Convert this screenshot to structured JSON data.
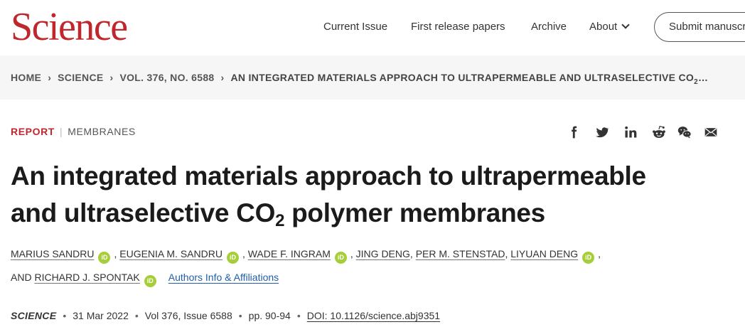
{
  "header": {
    "logo": "Science",
    "nav": [
      "Current Issue",
      "First release papers",
      "Archive",
      "About"
    ],
    "submit_label": "Submit manuscript"
  },
  "breadcrumb": {
    "items": [
      "HOME",
      "SCIENCE",
      "VOL. 376, NO. 6588"
    ],
    "current_pre": "AN INTEGRATED MATERIALS APPROACH TO ULTRAPERMEABLE AND ULTRASELECTIVE CO",
    "current_sub": "2",
    "current_post": "…"
  },
  "article": {
    "type": "REPORT",
    "topic": "MEMBRANES",
    "title_line1": "An integrated materials approach to ultrapermeable",
    "title_line2_pre": "and ultraselective CO",
    "title_sub": "2",
    "title_line2_post": " polymer membranes",
    "authors": [
      {
        "name": "MARIUS SANDRU",
        "orcid": true,
        "sep": ","
      },
      {
        "name": "EUGENIA M. SANDRU",
        "orcid": true,
        "sep": ","
      },
      {
        "name": "WADE F. INGRAM",
        "orcid": true,
        "sep": ","
      },
      {
        "name": "JING DENG",
        "orcid": false,
        "sep": ","
      },
      {
        "name": "PER M. STENSTAD",
        "orcid": false,
        "sep": ","
      },
      {
        "name": "LIYUAN DENG",
        "orcid": true,
        "sep": ","
      },
      {
        "name": "RICHARD J. SPONTAK",
        "orcid": true,
        "sep": ""
      }
    ],
    "and_label": "AND",
    "affiliations_link": "Authors Info & Affiliations",
    "orcid_label": "iD",
    "journal": "SCIENCE",
    "date": "31 Mar 2022",
    "volume": "Vol 376, Issue 6588",
    "pages": "pp. 90-94",
    "doi": "DOI: 10.1126/science.abj9351"
  },
  "share_icons": [
    "facebook-icon",
    "twitter-icon",
    "linkedin-icon",
    "reddit-icon",
    "wechat-icon",
    "email-icon"
  ],
  "colors": {
    "brand": "#c0272d",
    "link": "#1f5ea8",
    "orcid": "#a6ce39"
  }
}
